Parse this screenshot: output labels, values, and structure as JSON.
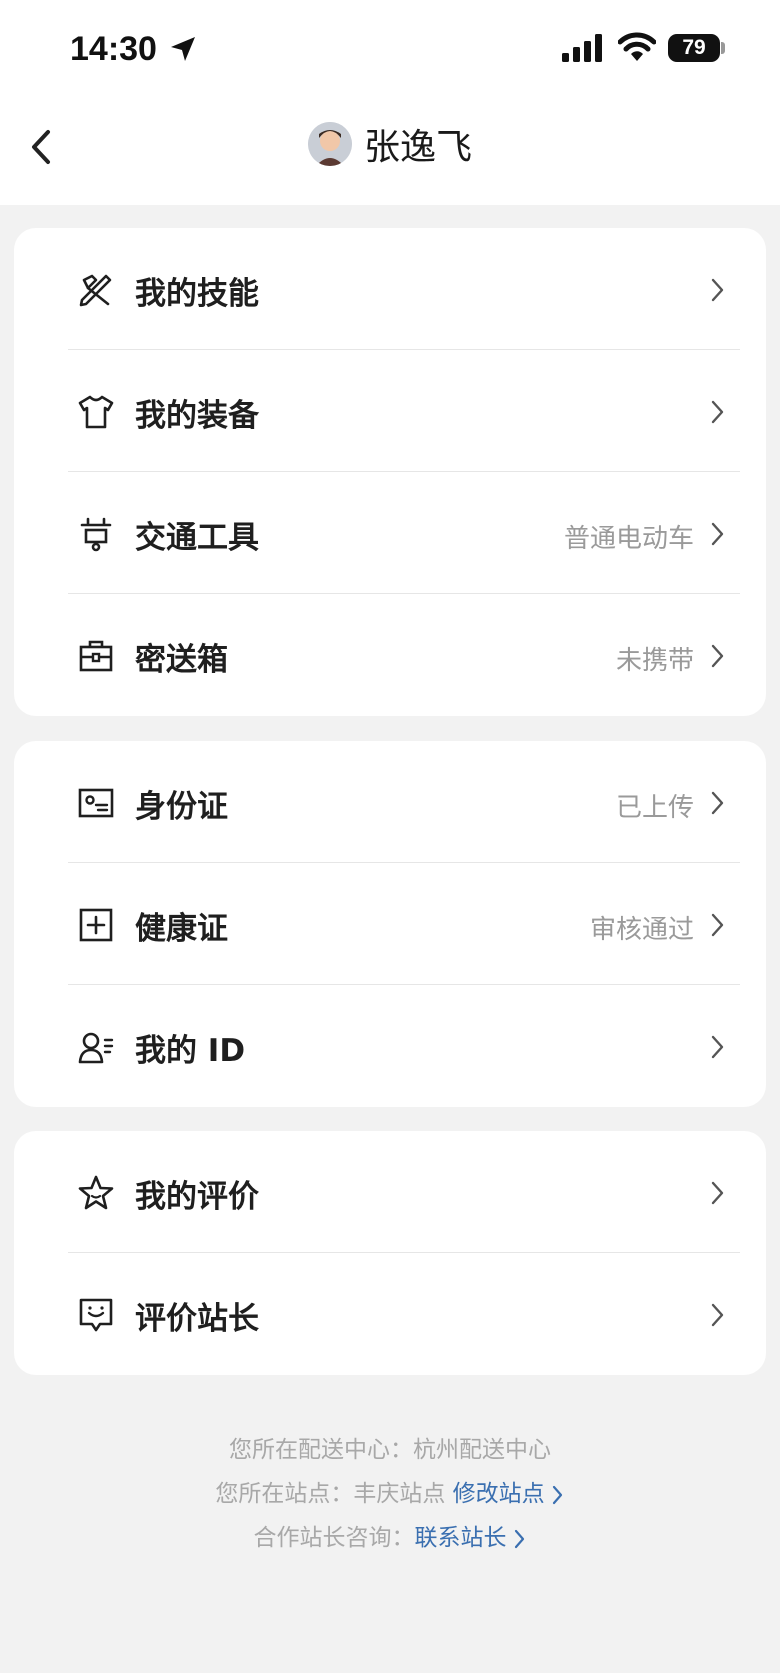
{
  "status_bar": {
    "time": "14:30",
    "battery": "79"
  },
  "nav": {
    "title": "张逸飞"
  },
  "groups": [
    {
      "items": [
        {
          "label": "我的技能",
          "value": "",
          "icon": "tools-icon"
        },
        {
          "label": "我的装备",
          "value": "",
          "icon": "tshirt-icon"
        },
        {
          "label": "交通工具",
          "value": "普通电动车",
          "icon": "scooter-icon"
        },
        {
          "label": "密送箱",
          "value": "未携带",
          "icon": "delivery-box-icon"
        }
      ]
    },
    {
      "items": [
        {
          "label": "身份证",
          "value": "已上传",
          "icon": "id-card-icon"
        },
        {
          "label": "健康证",
          "value": "审核通过",
          "icon": "health-cert-icon"
        },
        {
          "label": "我的 ID",
          "value": "",
          "icon": "user-id-icon"
        }
      ]
    },
    {
      "items": [
        {
          "label": "我的评价",
          "value": "",
          "icon": "star-icon"
        },
        {
          "label": "评价站长",
          "value": "",
          "icon": "feedback-icon"
        }
      ]
    }
  ],
  "footer": {
    "center_label": "您所在配送中心：",
    "center_value": "杭州配送中心",
    "station_label": "您所在站点：",
    "station_value": "丰庆站点",
    "station_link": "修改站点",
    "consult_label": "合作站长咨询：",
    "consult_link": "联系站长"
  },
  "colors": {
    "background": "#f2f2f2",
    "card": "#ffffff",
    "link": "#3a6fb0",
    "value_text": "#9a9a9a"
  }
}
